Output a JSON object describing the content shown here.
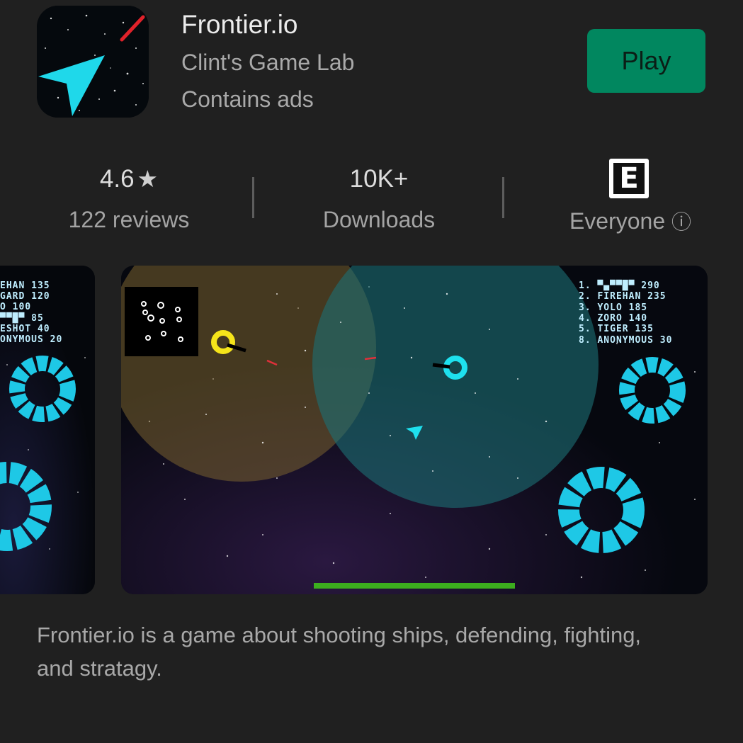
{
  "app": {
    "title": "Frontier.io",
    "developer": "Clint's Game Lab",
    "ads_note": "Contains ads",
    "icon": "arrow-ship-icon"
  },
  "actions": {
    "play_label": "Play"
  },
  "stats": {
    "rating_value": "4.6",
    "rating_star": "★",
    "reviews_label": "122 reviews",
    "downloads_value": "10K+",
    "downloads_label": "Downloads",
    "content_rating_badge": "E",
    "content_rating_label": "Everyone",
    "info_icon": "ⓘ"
  },
  "screenshots": {
    "main_leaderboard": [
      "1. ▀▄▀▀█▀ 290",
      "2. FIREHAN 235",
      "3. YOLO 185",
      "4. ZORO 140",
      "5. TIGER 135",
      "8. ANONYMOUS 30"
    ],
    "left_leaderboard": [
      "EHAN 135",
      "GARD 120",
      "O 100",
      "▀▀█▀ 85",
      "ESHOT 40",
      "ONYMOUS 20"
    ]
  },
  "description": "Frontier.io is a game about shooting ships, defending, fighting, and stratagy.",
  "colors": {
    "background": "#202020",
    "play_button": "#01875f",
    "cyan_accent": "#1ec8e6",
    "yellow_player": "#f5e41a"
  }
}
